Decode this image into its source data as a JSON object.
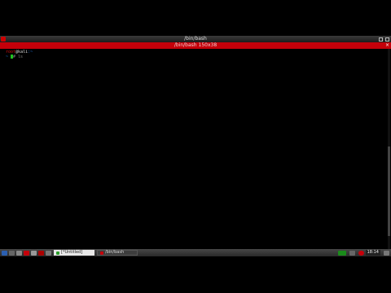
{
  "window": {
    "title": "/bin/bash"
  },
  "tab": {
    "label": "/bin/bash 150x38"
  },
  "terminal": {
    "line1": {
      "user": "root",
      "host": "@kali",
      "rest": ":~"
    },
    "line2": {
      "dir": "~",
      "hash": "# ls"
    }
  },
  "taskbar": {
    "tasks": [
      {
        "label": "[*Untitled]"
      },
      {
        "label": "/bin/bash"
      }
    ],
    "clock": "18:14"
  },
  "colors": {
    "tab_bar": "#c4000a",
    "prompt_user": "#e01010",
    "cursor": "#1fc01f"
  }
}
